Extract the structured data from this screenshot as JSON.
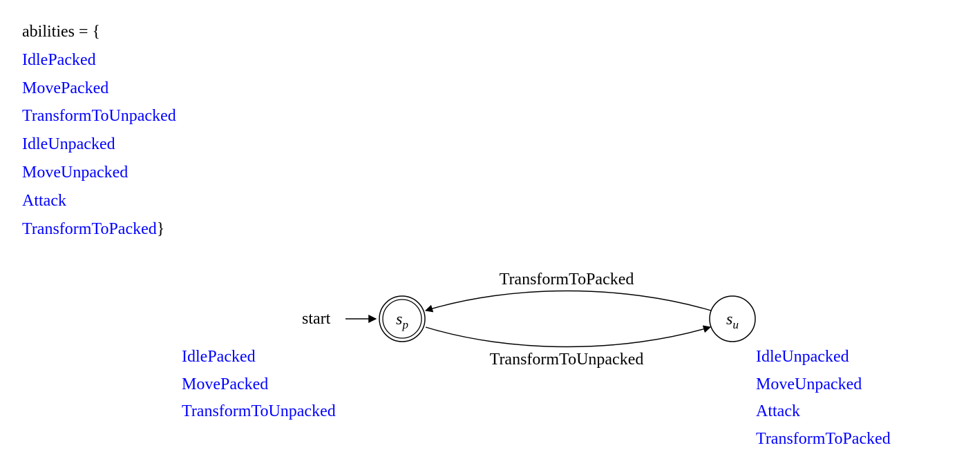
{
  "abilities_header": "abilities = {",
  "abilities": [
    "IdlePacked",
    "MovePacked",
    "TransformToUnpacked",
    "IdleUnpacked",
    "MoveUnpacked",
    "Attack",
    "TransformToPacked"
  ],
  "abilities_close": "}",
  "diagram": {
    "start_label": "start",
    "state_p": {
      "var": "s",
      "sub": "p"
    },
    "state_u": {
      "var": "s",
      "sub": "u"
    },
    "edge_top_label": "TransformToPacked",
    "edge_bottom_label": "TransformToUnpacked",
    "packed_list": [
      "IdlePacked",
      "MovePacked",
      "TransformToUnpacked"
    ],
    "unpacked_list": [
      "IdleUnpacked",
      "MoveUnpacked",
      "Attack",
      "TransformToPacked"
    ]
  }
}
